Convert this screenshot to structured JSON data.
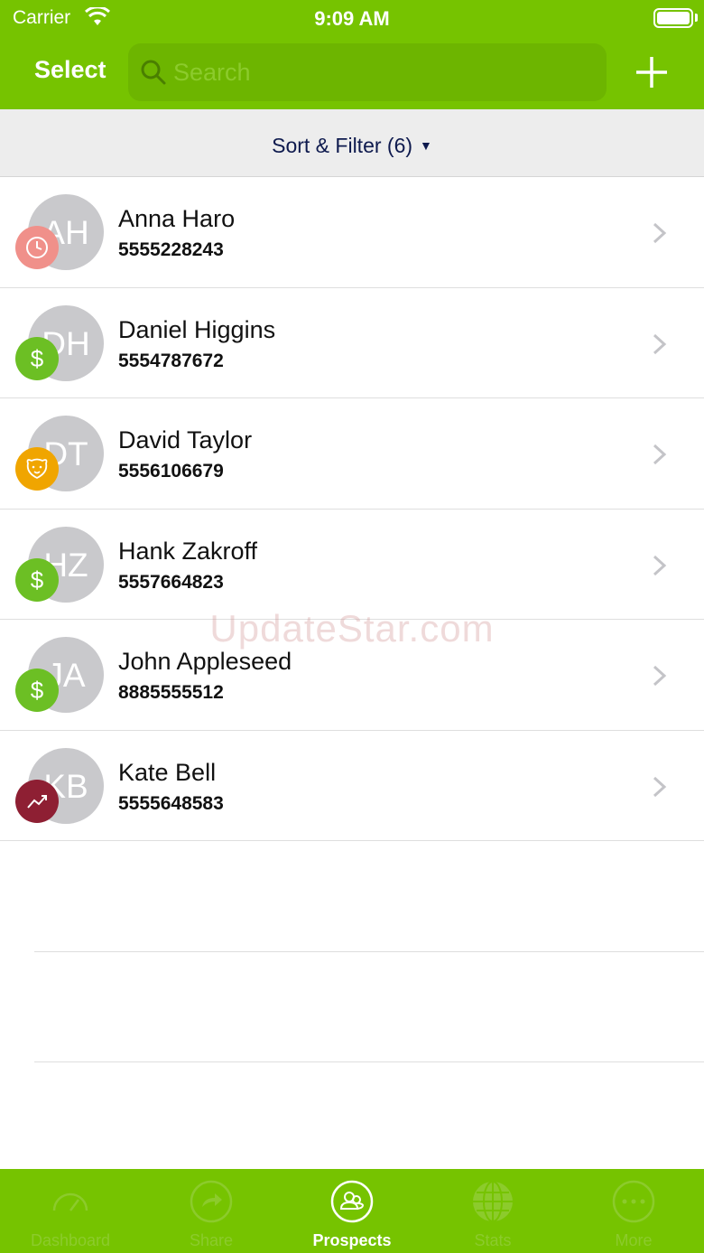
{
  "status_bar": {
    "carrier": "Carrier",
    "time": "9:09 AM"
  },
  "nav": {
    "select_label": "Select",
    "search_placeholder": "Search"
  },
  "sort_filter": {
    "label": "Sort & Filter (6)"
  },
  "contacts": [
    {
      "initials": "AH",
      "name": "Anna Haro",
      "phone": "5555228243",
      "badge": "clock-icon",
      "badge_color": "#f0908a"
    },
    {
      "initials": "DH",
      "name": "Daniel Higgins",
      "phone": "5554787672",
      "badge": "dollar-icon",
      "badge_color": "#6cbf24"
    },
    {
      "initials": "DT",
      "name": "David Taylor",
      "phone": "5556106679",
      "badge": "dog-face-icon",
      "badge_color": "#f0a500"
    },
    {
      "initials": "HZ",
      "name": "Hank Zakroff",
      "phone": "5557664823",
      "badge": "dollar-icon",
      "badge_color": "#6cbf24"
    },
    {
      "initials": "JA",
      "name": "John Appleseed",
      "phone": "8885555512",
      "badge": "dollar-icon",
      "badge_color": "#6cbf24"
    },
    {
      "initials": "KB",
      "name": "Kate Bell",
      "phone": "5555648583",
      "badge": "trend-up-icon",
      "badge_color": "#8e1f33"
    }
  ],
  "watermark": "UpdateStar.com",
  "tabs": [
    {
      "label": "Dashboard",
      "icon": "gauge-icon",
      "active": false
    },
    {
      "label": "Share",
      "icon": "share-arrow-icon",
      "active": false
    },
    {
      "label": "Prospects",
      "icon": "people-icon",
      "active": true
    },
    {
      "label": "Stats",
      "icon": "globe-icon",
      "active": false
    },
    {
      "label": "More",
      "icon": "ellipsis-icon",
      "active": false
    }
  ],
  "colors": {
    "brand_green": "#76c300",
    "sort_text": "#0e1a4e",
    "avatar_gray": "#c9c9cc"
  }
}
